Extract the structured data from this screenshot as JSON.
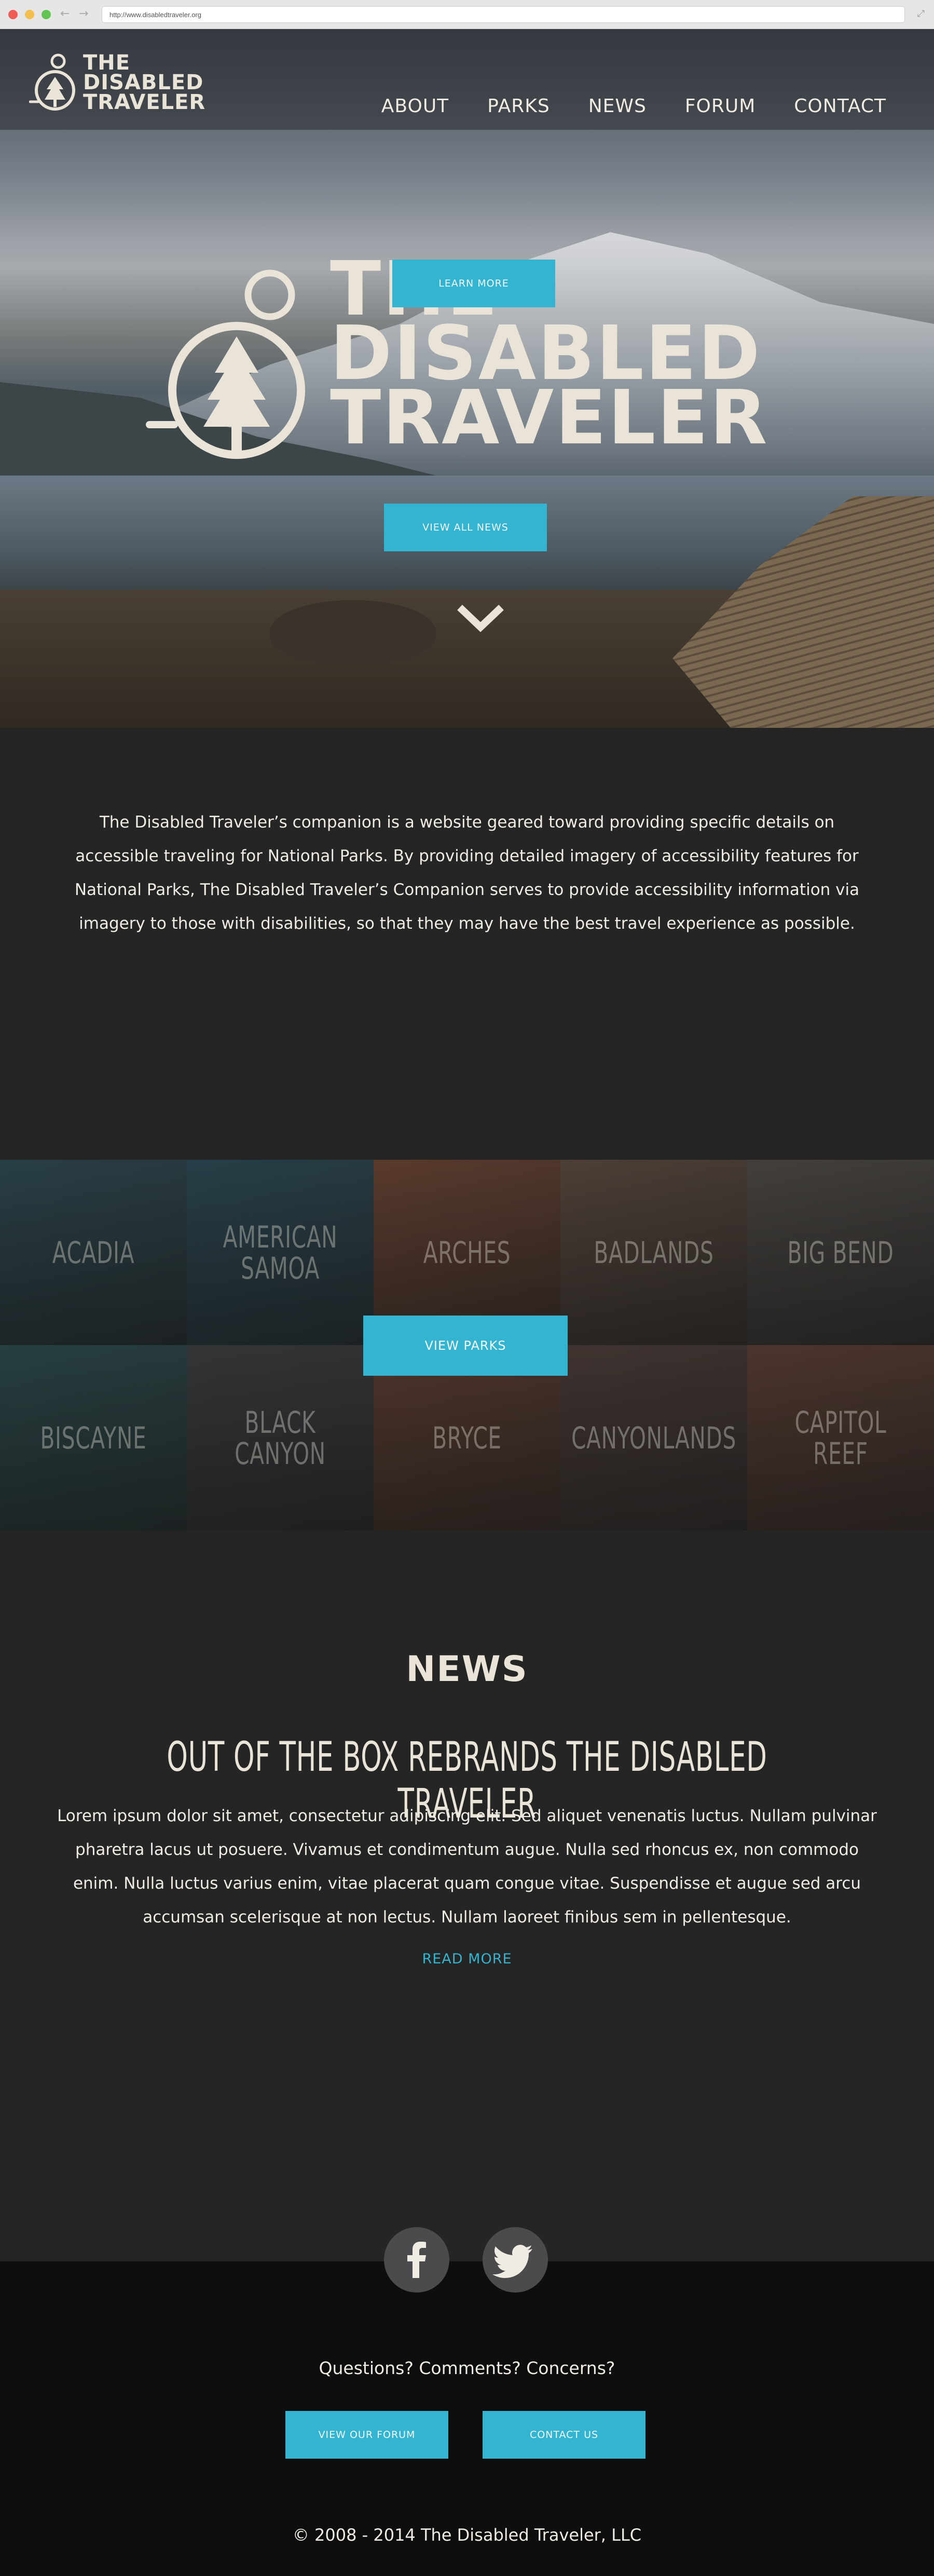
{
  "browser": {
    "url": "http://www.disabledtraveler.org",
    "back_icon": "arrow-left-icon",
    "forward_icon": "arrow-right-icon",
    "expand_icon": "expand-icon"
  },
  "site": {
    "logo_lines": [
      "THE",
      "DISABLED",
      "TRAVELER"
    ],
    "nav": [
      "ABOUT",
      "PARKS",
      "NEWS",
      "FORUM",
      "CONTACT"
    ],
    "scroll_icon": "chevron-down-icon"
  },
  "intro": {
    "text": "The Disabled Traveler’s companion is a website geared toward providing specific details on accessible traveling for National Parks. By providing detailed imagery of accessibility features for National Parks, The Disabled Traveler’s Companion serves to provide accessibility information via imagery to those with disabilities, so that they may have the best travel experience as possible.",
    "button": "LEARN MORE"
  },
  "parks": {
    "items": [
      {
        "name": "ACADIA",
        "color": "#2f4a52"
      },
      {
        "name": "AMERICAN SAMOA",
        "color": "#2d4a55"
      },
      {
        "name": "ARCHES",
        "color": "#6a4434"
      },
      {
        "name": "BADLANDS",
        "color": "#5a4a40"
      },
      {
        "name": "BIG BEND",
        "color": "#4e4a46"
      },
      {
        "name": "BISCAYNE",
        "color": "#2d4a4c"
      },
      {
        "name": "BLACK CANYON",
        "color": "#3c3e40"
      },
      {
        "name": "BRYCE",
        "color": "#5e3e32"
      },
      {
        "name": "CANYONLANDS",
        "color": "#4a3c38"
      },
      {
        "name": "CAPITOL REEF",
        "color": "#5a3e34"
      }
    ],
    "button": "VIEW PARKS"
  },
  "news": {
    "title": "NEWS",
    "headline": "OUT OF THE BOX REBRANDS THE DISABLED TRAVELER",
    "body": "Lorem ipsum dolor sit amet, consectetur adipiscing elit. Sed aliquet venenatis luctus. Nullam pulvinar pharetra lacus ut posuere. Vivamus et condimentum augue. Nulla sed rhoncus ex, non commodo enim. Nulla luctus varius enim, vitae placerat quam congue vitae. Suspendisse et augue sed arcu accumsan scelerisque at non lectus. Nullam laoreet finibus sem in pellentesque.",
    "read_more": "READ MORE",
    "button": "VIEW ALL NEWS"
  },
  "social": {
    "facebook_icon": "facebook-icon",
    "twitter_icon": "twitter-icon"
  },
  "footer": {
    "question": "Questions? Comments? Concerns?",
    "forum_button": "VIEW OUR FORUM",
    "contact_button": "CONTACT US",
    "copyright": "© 2008 - 2014 The Disabled Traveler, LLC"
  },
  "colors": {
    "accent": "#33b4d0",
    "cream": "#eae4d8",
    "dark": "#252525",
    "footer": "#0e0e0e"
  }
}
